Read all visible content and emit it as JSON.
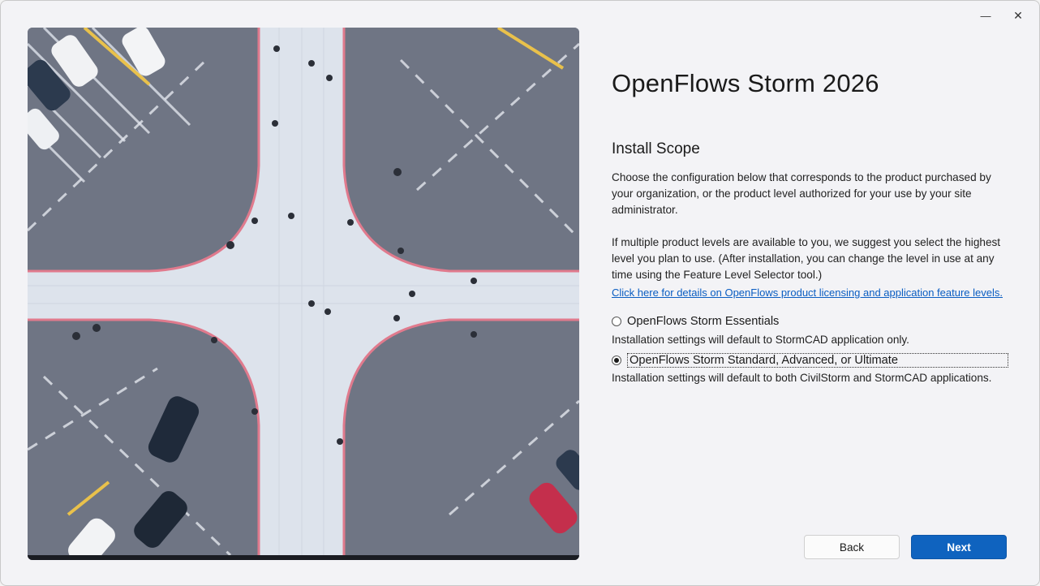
{
  "window": {
    "minimize_glyph": "—",
    "close_glyph": "✕"
  },
  "header": {
    "app_title": "OpenFlows Storm 2026"
  },
  "scope": {
    "section_title": "Install Scope",
    "paragraph1": "Choose the configuration below that corresponds to the product purchased by your organization, or the product level authorized for your use by your site administrator.",
    "paragraph2": "If multiple product levels are available to you, we suggest you select the highest level you plan to use. (After installation, you can change the level in use at any time using the Feature Level Selector tool.)",
    "link_text": "Click here for details on OpenFlows product licensing and application feature levels.",
    "options": [
      {
        "label": "OpenFlows Storm Essentials",
        "description": "Installation settings will default to StormCAD application only.",
        "selected": false
      },
      {
        "label": "OpenFlows Storm Standard, Advanced, or Ultimate",
        "description": "Installation settings will default to both CivilStorm and StormCAD applications.",
        "selected": true
      }
    ]
  },
  "footer": {
    "back_label": "Back",
    "next_label": "Next"
  },
  "colors": {
    "accent": "#0f63bf",
    "link": "#0a5dc2"
  }
}
